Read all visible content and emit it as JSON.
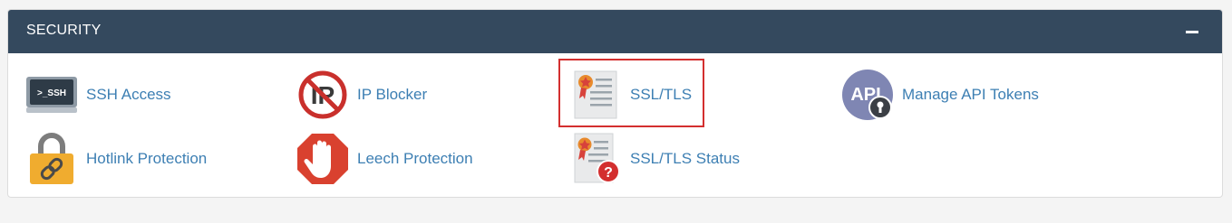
{
  "section": {
    "title": "SECURITY",
    "collapse_glyph": "−"
  },
  "items": [
    {
      "label": "SSH Access",
      "icon": "ssh-terminal-icon",
      "icon_text": ">_SSH"
    },
    {
      "label": "IP Blocker",
      "icon": "ip-blocker-icon",
      "icon_text": "IP"
    },
    {
      "label": "SSL/TLS",
      "icon": "ssl-certificate-icon",
      "selected": true
    },
    {
      "label": "Manage API Tokens",
      "icon": "api-token-icon",
      "icon_text": "API"
    },
    {
      "label": "Hotlink Protection",
      "icon": "hotlink-lock-icon"
    },
    {
      "label": "Leech Protection",
      "icon": "leech-hand-icon"
    },
    {
      "label": "SSL/TLS Status",
      "icon": "ssl-status-icon",
      "icon_text": "?"
    }
  ],
  "colors": {
    "header_bg": "#34495e",
    "link": "#3d7fb3",
    "highlight": "#d32f2f"
  }
}
